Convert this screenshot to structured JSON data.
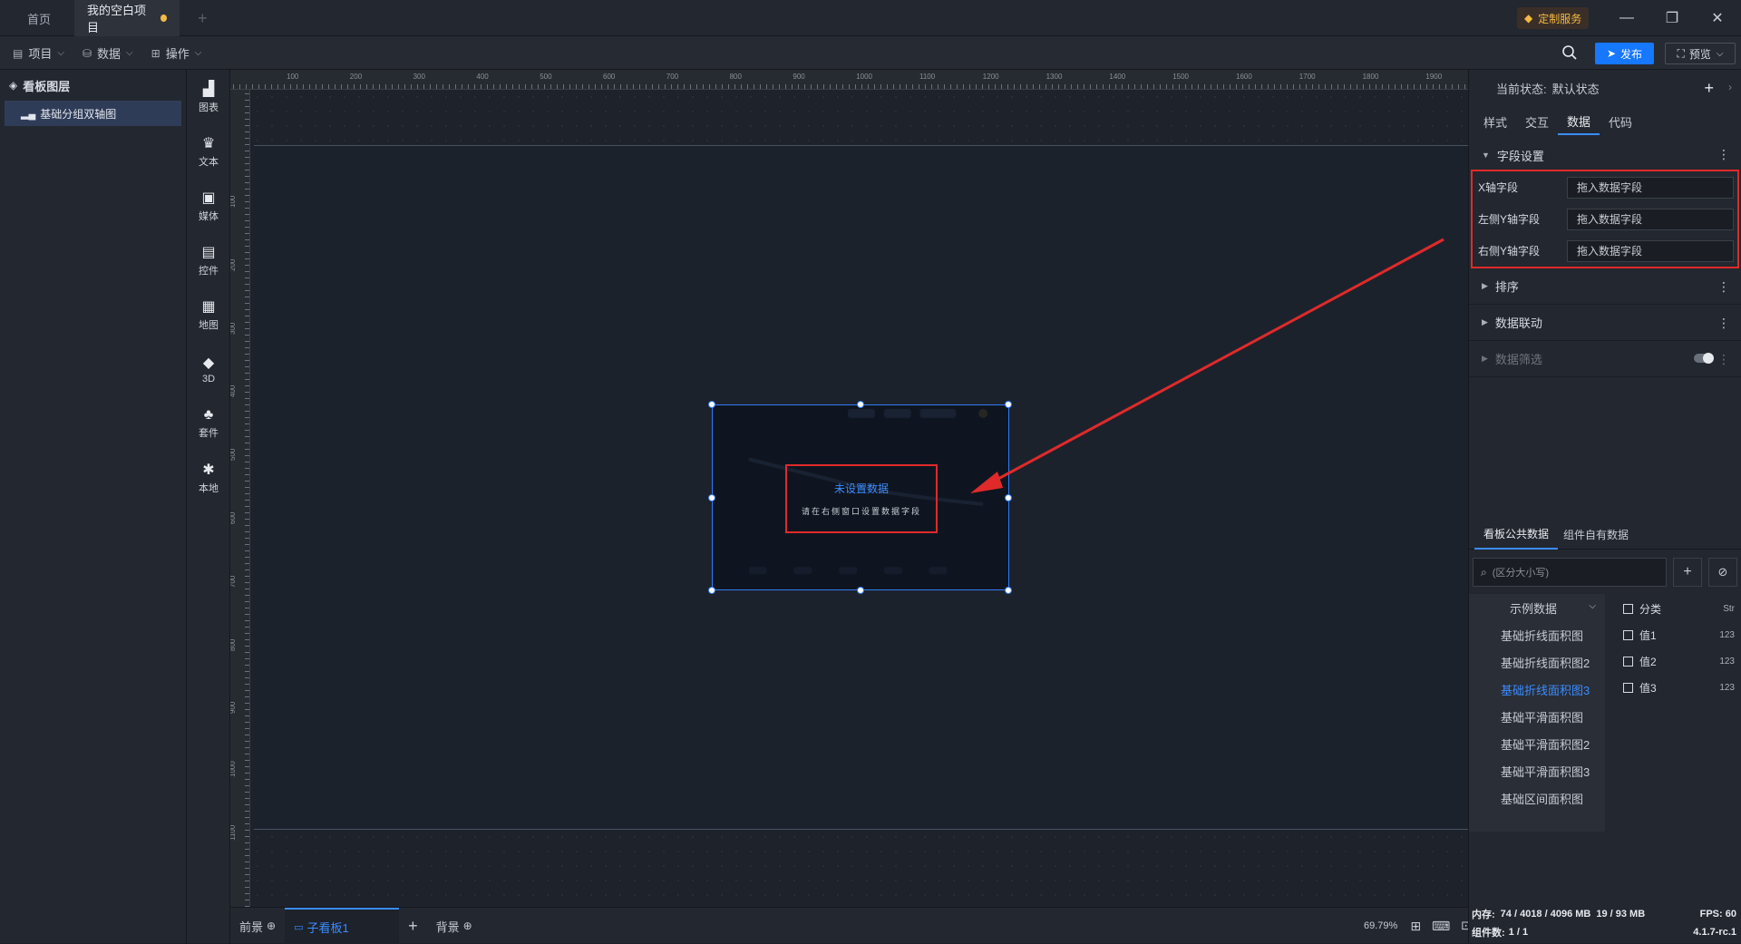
{
  "title_bar": {
    "tabs": [
      {
        "label": "首页"
      },
      {
        "label": "我的空白项目"
      }
    ],
    "new_tab": "+",
    "custom_service": "定制服务",
    "minimize": "—",
    "restore": "❐",
    "close": "✕"
  },
  "menu_bar": {
    "project": "项目",
    "data": "数据",
    "operation": "操作",
    "publish": "发布",
    "preview": "预览"
  },
  "layers": {
    "header": "看板图层",
    "items": [
      {
        "label": "基础分组双轴图"
      }
    ]
  },
  "toolbox": [
    {
      "label": "图表",
      "icon": "bar-chart-icon"
    },
    {
      "label": "文本",
      "icon": "text-icon"
    },
    {
      "label": "媒体",
      "icon": "media-icon"
    },
    {
      "label": "控件",
      "icon": "control-icon"
    },
    {
      "label": "地图",
      "icon": "map-icon"
    },
    {
      "label": "3D",
      "icon": "cube-icon"
    },
    {
      "label": "套件",
      "icon": "kit-icon"
    },
    {
      "label": "本地",
      "icon": "puzzle-icon"
    }
  ],
  "rulers": {
    "top": [
      "100",
      "200",
      "300",
      "400",
      "500",
      "600",
      "700",
      "800",
      "900",
      "1000",
      "1100",
      "1200",
      "1300",
      "1400",
      "1500",
      "1600",
      "1700",
      "1800",
      "1900"
    ],
    "left": [
      "100",
      "200",
      "300",
      "400",
      "500",
      "600",
      "700",
      "800",
      "900",
      "1000",
      "1100"
    ]
  },
  "component": {
    "empty_title": "未设置数据",
    "empty_hint": "请在右侧窗口设置数据字段"
  },
  "bottom_bar": {
    "foreground": "前景",
    "sub_board": "子看板1",
    "add": "+",
    "background": "背景",
    "zoom": "69.79%"
  },
  "right_panel": {
    "state_label": "当前状态:",
    "state_value": "默认状态",
    "tabs": [
      "样式",
      "交互",
      "数据",
      "代码"
    ],
    "active_tab": "数据",
    "field_settings": {
      "title": "字段设置",
      "fields": [
        {
          "label": "X轴字段",
          "placeholder": "拖入数据字段"
        },
        {
          "label": "左侧Y轴字段",
          "placeholder": "拖入数据字段"
        },
        {
          "label": "右侧Y轴字段",
          "placeholder": "拖入数据字段"
        }
      ]
    },
    "sections": [
      "排序",
      "数据联动",
      "数据筛选"
    ],
    "data_tabs": [
      "看板公共数据",
      "组件自有数据"
    ],
    "search_placeholder": "(区分大小写)",
    "dataset_group": "示例数据",
    "datasets": [
      {
        "label": "基础折线面积图"
      },
      {
        "label": "基础折线面积图2"
      },
      {
        "label": "基础折线面积图3"
      },
      {
        "label": "基础平滑面积图"
      },
      {
        "label": "基础平滑面积图2"
      },
      {
        "label": "基础平滑面积图3"
      },
      {
        "label": "基础区间面积图"
      }
    ],
    "active_dataset": "基础折线面积图3",
    "data_fields": [
      {
        "name": "分类",
        "type": "Str"
      },
      {
        "name": "值1",
        "type": "123"
      },
      {
        "name": "值2",
        "type": "123"
      },
      {
        "name": "值3",
        "type": "123"
      }
    ]
  },
  "status_bar": {
    "memory_label": "内存:",
    "memory_value": "74 / 4018 / 4096 MB",
    "memory_extra": "19 / 93 MB",
    "fps_label": "FPS:",
    "fps_value": "60",
    "component_count_label": "组件数:",
    "component_count_value": "1 / 1",
    "version": "4.1.7-rc.1"
  },
  "colors": {
    "accent": "#3b8cff",
    "highlight_red": "#e02a2a",
    "modified_dot": "#f5b942"
  }
}
